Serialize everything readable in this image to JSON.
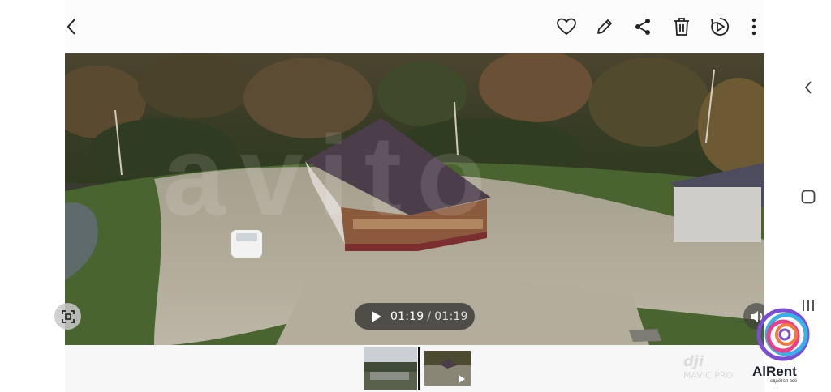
{
  "toolbar": {
    "back_icon": "chevron-left-icon",
    "actions": [
      "heart-icon",
      "pencil-icon",
      "share-icon",
      "trash-icon",
      "motion-photo-icon",
      "more-vert-icon"
    ]
  },
  "video": {
    "overlay_watermark": "avito",
    "current_time": "01:19",
    "separator": "/",
    "duration": "01:19",
    "camera_watermark_brand": "dji",
    "camera_watermark_model": "MAVIC PRO"
  },
  "filmstrip": {
    "thumbnail_count": 2,
    "second_is_video": true
  },
  "system_nav": {
    "icons": [
      "back-icon",
      "home-icon",
      "recents-icon"
    ]
  },
  "logo": {
    "brand": "AlRent",
    "tagline": "сдаётся всё"
  }
}
